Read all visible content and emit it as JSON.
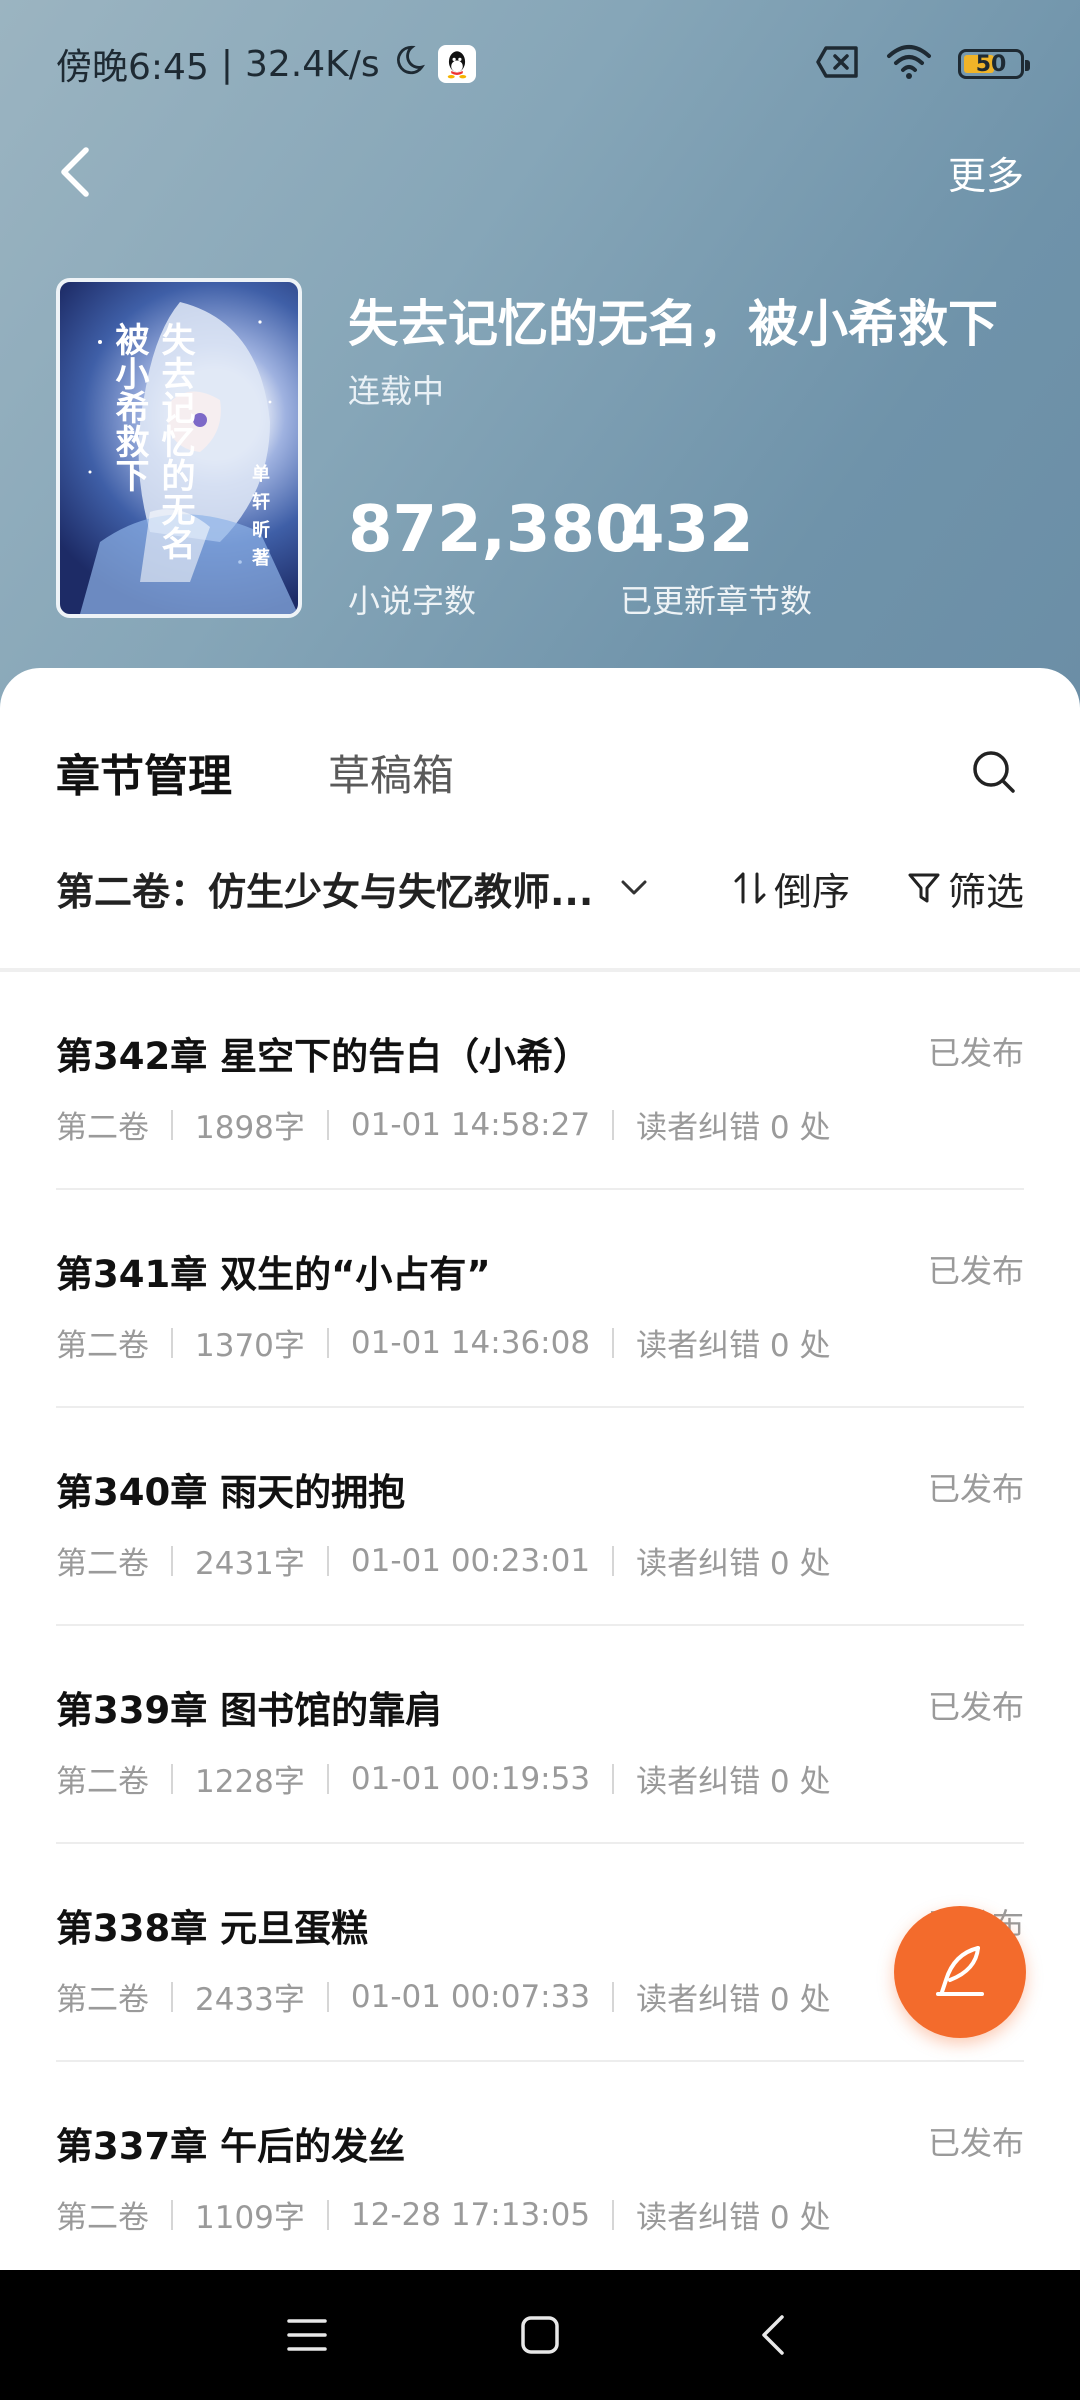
{
  "status_bar": {
    "time": "傍晚6:45",
    "speed": "32.4K/s",
    "battery_level": "50",
    "battery_color": "#f0b428"
  },
  "nav": {
    "back_icon": "chevron-left-icon",
    "more_label": "更多"
  },
  "book": {
    "cover_title": "失去记忆的无名被小希救下",
    "cover_author": "单轩昕著",
    "title": "失去记忆的无名，被小希救下",
    "status": "连载中",
    "word_count": "872,380",
    "word_count_label": "小说字数",
    "chapter_count": "432",
    "chapter_count_label": "已更新章节数"
  },
  "tabs": [
    {
      "label": "章节管理",
      "active": true
    },
    {
      "label": "草稿箱",
      "active": false
    }
  ],
  "filter": {
    "volume": "第二卷：仿生少女与失忆教师...",
    "sort_label": "倒序",
    "filter_label": "筛选"
  },
  "chapters": [
    {
      "title": "第342章 星空下的告白（小希）",
      "status": "已发布",
      "volume": "第二卷",
      "words": "1898字",
      "time": "01-01 14:58:27",
      "errors": "读者纠错 0 处"
    },
    {
      "title": "第341章 双生的“小占有”",
      "status": "已发布",
      "volume": "第二卷",
      "words": "1370字",
      "time": "01-01 14:36:08",
      "errors": "读者纠错 0 处"
    },
    {
      "title": "第340章 雨天的拥抱",
      "status": "已发布",
      "volume": "第二卷",
      "words": "2431字",
      "time": "01-01 00:23:01",
      "errors": "读者纠错 0 处"
    },
    {
      "title": "第339章 图书馆的靠肩",
      "status": "已发布",
      "volume": "第二卷",
      "words": "1228字",
      "time": "01-01 00:19:53",
      "errors": "读者纠错 0 处"
    },
    {
      "title": "第338章 元旦蛋糕",
      "status": "已发布",
      "volume": "第二卷",
      "words": "2433字",
      "time": "01-01 00:07:33",
      "errors": "读者纠错 0 处"
    },
    {
      "title": "第337章 午后的发丝",
      "status": "已发布",
      "volume": "第二卷",
      "words": "1109字",
      "time": "12-28 17:13:05",
      "errors": "读者纠错 0 处"
    }
  ],
  "fab": {
    "icon": "quill-pen-icon",
    "color": "#f36b2c"
  },
  "system_nav": [
    "menu-icon",
    "home-icon",
    "back-icon"
  ]
}
